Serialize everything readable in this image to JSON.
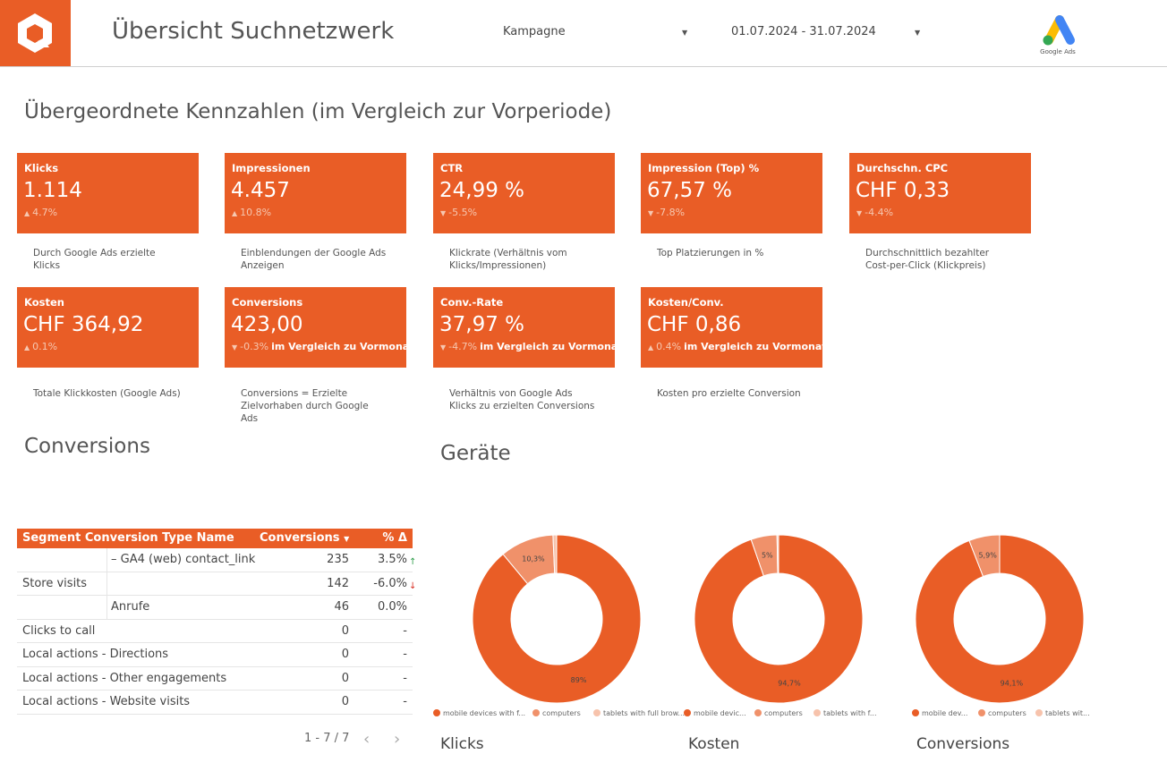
{
  "header": {
    "title": "Übersicht Suchnetzwerk",
    "campaign_label": "Kampagne",
    "date_range": "01.07.2024 - 31.07.2024",
    "gads_text": "Google Ads",
    "accent": "#e95d26"
  },
  "kpi_section": {
    "title": "Übergeordnete Kennzahlen (im Vergleich zur Vorperiode)"
  },
  "kpis": [
    {
      "label": "Klicks",
      "value": "1.114",
      "delta": "4.7%",
      "direction": "up",
      "suffix": "",
      "desc": "Durch Google Ads erzielte Klicks"
    },
    {
      "label": "Impressionen",
      "value": "4.457",
      "delta": "10.8%",
      "direction": "up",
      "suffix": "",
      "desc": "Einblendungen der Google Ads Anzeigen"
    },
    {
      "label": "CTR",
      "value": "24,99 %",
      "delta": "-5.5%",
      "direction": "down",
      "suffix": "",
      "desc": "Klickrate (Verhältnis vom Klicks/Impressionen)"
    },
    {
      "label": "Impression (Top) %",
      "value": "67,57 %",
      "delta": "-7.8%",
      "direction": "down",
      "suffix": "",
      "desc": "Top Platzierungen in %"
    },
    {
      "label": "Durchschn. CPC",
      "value": "CHF 0,33",
      "delta": "-4.4%",
      "direction": "down",
      "suffix": "",
      "desc": "Durchschnittlich bezahlter Cost-per-Click (Klickpreis)"
    },
    {
      "label": "Kosten",
      "value": "CHF 364,92",
      "delta": "0.1%",
      "direction": "up",
      "suffix": "",
      "desc": "Totale Klickkosten (Google Ads)"
    },
    {
      "label": "Conversions",
      "value": "423,00",
      "delta": "-0.3%",
      "direction": "down",
      "suffix": "im Vergleich zu Vormonat",
      "desc": "Conversions = Erzielte Zielvorhaben durch Google Ads"
    },
    {
      "label": "Conv.-Rate",
      "value": "37,97 %",
      "delta": "-4.7%",
      "direction": "down",
      "suffix": "im Vergleich zu Vormonat",
      "desc": "Verhältnis von Google Ads Klicks zu erzielten Conversions"
    },
    {
      "label": "Kosten/Conv.",
      "value": "CHF 0,86",
      "delta": "0.4%",
      "direction": "up",
      "suffix": "im Vergleich zu Vormonat",
      "desc": "Kosten pro erzielte Conversion"
    }
  ],
  "conversions": {
    "title": "Conversions",
    "headers": {
      "segment": "Segment Conversion Type Name",
      "conversions": "Conversions",
      "sort_icon": "sort-down-icon",
      "delta": "% Δ"
    },
    "rows": [
      {
        "segment": "",
        "type": "– GA4 (web) contact_link",
        "value": "235",
        "delta": "3.5%",
        "trend": "up"
      },
      {
        "segment": "Store visits",
        "type": "",
        "value": "142",
        "delta": "-6.0%",
        "trend": "down"
      },
      {
        "segment": "",
        "type": "Anrufe",
        "value": "46",
        "delta": "0.0%",
        "trend": ""
      },
      {
        "segment": "Clicks to call",
        "type": "",
        "value": "0",
        "delta": "-",
        "trend": ""
      },
      {
        "segment": "Local actions - Directions",
        "type": "",
        "value": "0",
        "delta": "-",
        "trend": ""
      },
      {
        "segment": "Local actions - Other engagements",
        "type": "",
        "value": "0",
        "delta": "-",
        "trend": ""
      },
      {
        "segment": "Local actions - Website visits",
        "type": "",
        "value": "0",
        "delta": "-",
        "trend": ""
      }
    ],
    "pager": "1 - 7 / 7"
  },
  "devices": {
    "title": "Geräte"
  },
  "chart_data": [
    {
      "type": "pie",
      "title": "Klicks",
      "categories": [
        "mobile devices with f...",
        "computers",
        "tablets with full brow..."
      ],
      "values": [
        89,
        10.3,
        0.7
      ],
      "labels": [
        "89%",
        "10,3%",
        ""
      ],
      "colors": [
        "#e95d26",
        "#f0916a",
        "#f7c3ac"
      ],
      "legend": "bottom"
    },
    {
      "type": "pie",
      "title": "Kosten",
      "categories": [
        "mobile devic...",
        "computers",
        "tablets with f..."
      ],
      "values": [
        94.7,
        5,
        0.3
      ],
      "labels": [
        "94,7%",
        "5%",
        ""
      ],
      "colors": [
        "#e95d26",
        "#f0916a",
        "#f7c3ac"
      ],
      "legend": "bottom"
    },
    {
      "type": "pie",
      "title": "Conversions",
      "categories": [
        "mobile dev...",
        "computers",
        "tablets wit..."
      ],
      "values": [
        94.1,
        5.9,
        0
      ],
      "labels": [
        "94,1%",
        "5,9%",
        ""
      ],
      "colors": [
        "#e95d26",
        "#f0916a",
        "#f7c3ac"
      ],
      "legend": "bottom"
    }
  ]
}
